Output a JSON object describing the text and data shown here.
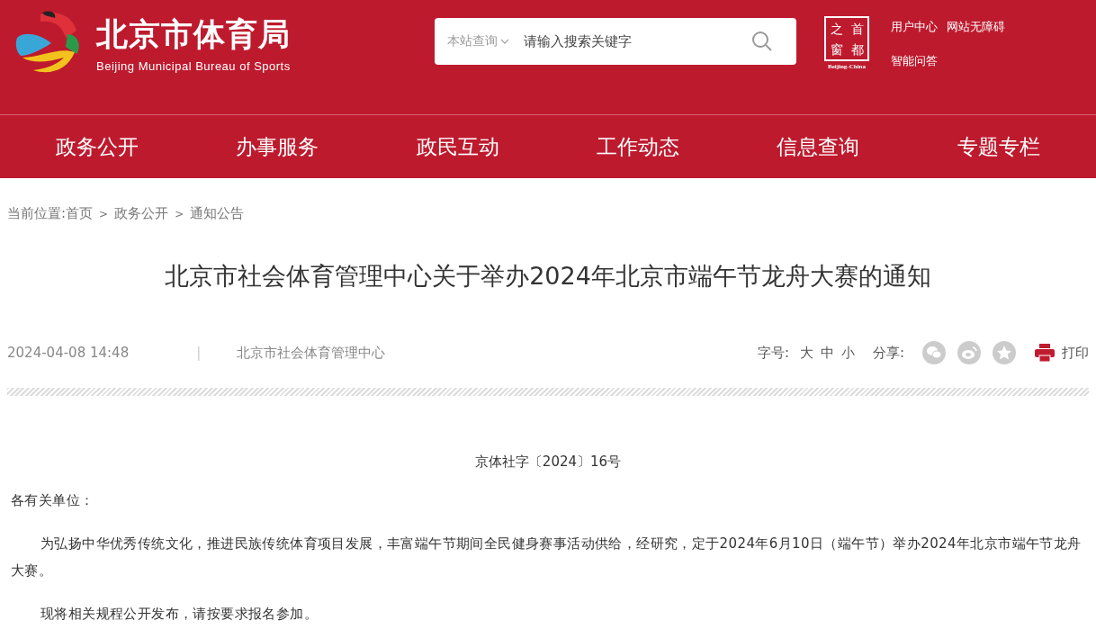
{
  "header": {
    "site_title": "北京市体育局",
    "site_subtitle": "Beijing Municipal Bureau of Sports",
    "search": {
      "scope": "本站查询",
      "placeholder": "请输入搜索关键字"
    },
    "badge": {
      "chars": [
        "之",
        "首",
        "窗",
        "都"
      ],
      "caption": "Beijing-China"
    },
    "links": [
      "用户中心",
      "网站无障碍",
      "智能问答"
    ]
  },
  "nav": [
    "政务公开",
    "办事服务",
    "政民互动",
    "工作动态",
    "信息查询",
    "专题专栏"
  ],
  "breadcrumb": {
    "label": "当前位置:",
    "separator": ">",
    "items": [
      "首页",
      "政务公开",
      "通知公告"
    ]
  },
  "article": {
    "title": "北京市社会体育管理中心关于举办2024年北京市端午节龙舟大赛的通知",
    "date": "2024-04-08 14:48",
    "meta_divider": "|",
    "source": "北京市社会体育管理中心",
    "font_size_label": "字号:",
    "font_sizes": [
      "大",
      "中",
      "小"
    ],
    "share_label": "分享:",
    "print": "打印",
    "doc_number": "京体社字〔2024〕16号",
    "paragraphs": [
      {
        "text": "各有关单位：",
        "indent": false
      },
      {
        "text": "为弘扬中华优秀传统文化，推进民族传统体育项目发展，丰富端午节期间全民健身赛事活动供给，经研究，定于2024年6月10日（端午节）举办2024年北京市端午节龙舟大赛。",
        "indent": true
      },
      {
        "text": "现将相关规程公开发布，请按要求报名参加。",
        "indent": true
      }
    ]
  }
}
